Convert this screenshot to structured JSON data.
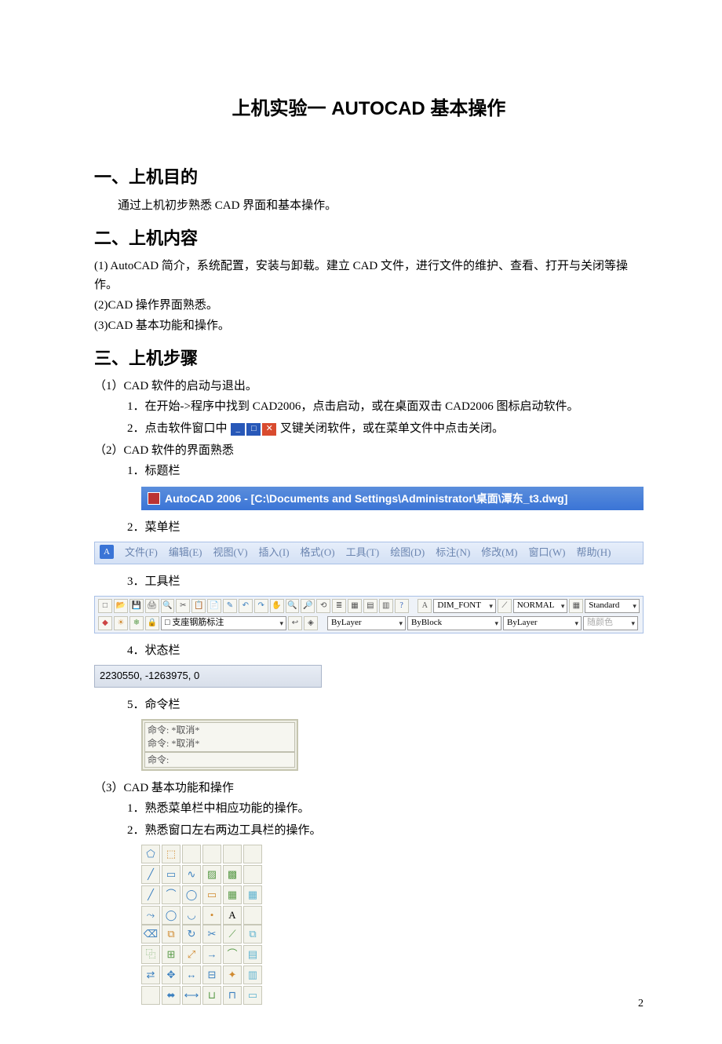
{
  "title": "上机实验一 AUTOCAD 基本操作",
  "section1": {
    "heading": "一、上机目的",
    "body": "通过上机初步熟悉 CAD 界面和基本操作。"
  },
  "section2": {
    "heading": "二、上机内容",
    "items": [
      "(1) AutoCAD 简介，系统配置，安装与卸载。建立 CAD 文件，进行文件的维护、查看、打开与关闭等操作。",
      "(2)CAD 操作界面熟悉。",
      "(3)CAD 基本功能和操作。"
    ]
  },
  "section3": {
    "heading": "三、上机步骤",
    "sub1": {
      "head": "（1）CAD 软件的启动与退出。",
      "step1": "1．在开始->程序中找到 CAD2006，点击启动，或在桌面双击 CAD2006 图标启动软件。",
      "step2_pre": "2．点击软件窗口中",
      "step2_post": "叉键关闭软件，或在菜单文件中点击关闭。"
    },
    "sub2": {
      "head": "（2）CAD 软件的界面熟悉",
      "l1": "1．标题栏",
      "l2": "2．菜单栏",
      "l3": "3．工具栏",
      "l4": "4．状态栏",
      "l5": "5．命令栏"
    },
    "sub3": {
      "head": "（3）CAD 基本功能和操作",
      "l1": "1．熟悉菜单栏中相应功能的操作。",
      "l2": "2．熟悉窗口左右两边工具栏的操作。"
    }
  },
  "titlebar": {
    "text": "AutoCAD 2006 - [C:\\Documents and Settings\\Administrator\\桌面\\潭东_t3.dwg]"
  },
  "menubar": {
    "items": [
      "文件(F)",
      "编辑(E)",
      "视图(V)",
      "插入(I)",
      "格式(O)",
      "工具(T)",
      "绘图(D)",
      "标注(N)",
      "修改(M)",
      "窗口(W)",
      "帮助(H)"
    ]
  },
  "toolbar": {
    "layer": "□ 支座钢筋标注",
    "bylayer1": "ByLayer",
    "byblock": "ByBlock",
    "bylayer2": "ByLayer",
    "dim_font": "DIM_FONT",
    "normal_style": "NORMAL",
    "standard": "Standard",
    "color_label": "随颜色"
  },
  "statusbar": {
    "coords": "2230550, -1263975, 0"
  },
  "command": {
    "l1": "命令:  *取消*",
    "l2": "命令:  *取消*",
    "l3": "命令:"
  },
  "page_number": "2"
}
